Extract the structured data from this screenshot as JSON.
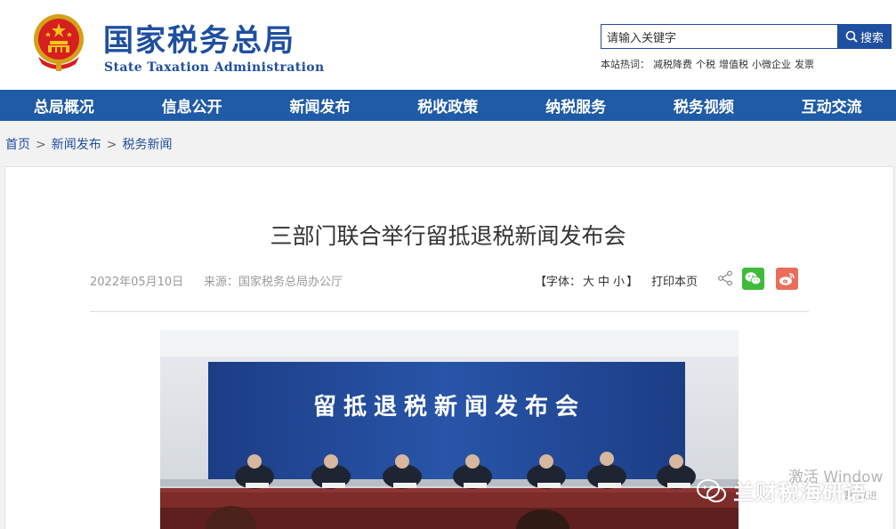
{
  "header": {
    "site_title": "国家税务总局",
    "site_title_en": "State Taxation Administration",
    "search": {
      "value": "请输入关键字",
      "button_label": "搜索"
    },
    "hotwords_label": "本站热词：",
    "hotwords": [
      "减税降费",
      "个税",
      "增值税",
      "小微企业",
      "发票"
    ]
  },
  "nav": {
    "items": [
      "总局概况",
      "信息公开",
      "新闻发布",
      "税收政策",
      "纳税服务",
      "税务视频",
      "互动交流"
    ]
  },
  "breadcrumb": [
    "首页",
    "新闻发布",
    "税务新闻"
  ],
  "breadcrumb_sep": ">",
  "article": {
    "title": "三部门联合举行留抵退税新闻发布会",
    "date": "2022年05月10日",
    "source": "来源：国家税务总局办公厅",
    "font_label": "【字体：",
    "font_sizes": [
      "大",
      "中",
      "小"
    ],
    "font_close": "】",
    "print_label": "打印本页",
    "photo_banner": "留抵退税新闻发布会"
  },
  "watermark": "兰财税海研语",
  "os_overlay": {
    "line1": "激活 Window",
    "line2": "置\"以进"
  },
  "colors": {
    "brand_blue": "#1f4fa0",
    "nav_blue": "#1f5ba6",
    "wechat": "#3fba3a",
    "weibo": "#e96d5a"
  }
}
